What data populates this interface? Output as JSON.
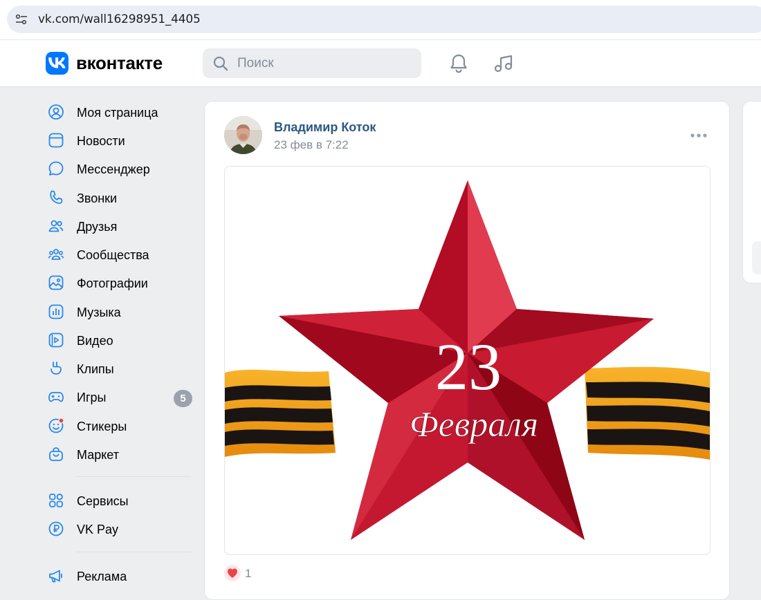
{
  "browser": {
    "url": "vk.com/wall16298951_4405"
  },
  "header": {
    "wordmark": "вконтакте",
    "search_placeholder": "Поиск",
    "accent_color": "#0077ff"
  },
  "sidebar": {
    "items": [
      {
        "label": "Моя страница",
        "icon": "profile-icon"
      },
      {
        "label": "Новости",
        "icon": "news-icon"
      },
      {
        "label": "Мессенджер",
        "icon": "messenger-icon"
      },
      {
        "label": "Звонки",
        "icon": "phone-icon"
      },
      {
        "label": "Друзья",
        "icon": "friends-icon"
      },
      {
        "label": "Сообщества",
        "icon": "communities-icon"
      },
      {
        "label": "Фотографии",
        "icon": "photos-icon"
      },
      {
        "label": "Музыка",
        "icon": "music-icon"
      },
      {
        "label": "Видео",
        "icon": "video-icon"
      },
      {
        "label": "Клипы",
        "icon": "clips-icon"
      },
      {
        "label": "Игры",
        "icon": "games-icon",
        "badge": "5"
      },
      {
        "label": "Стикеры",
        "icon": "stickers-icon"
      },
      {
        "label": "Маркет",
        "icon": "market-icon"
      },
      {
        "label": "Сервисы",
        "icon": "services-icon"
      },
      {
        "label": "VK Pay",
        "icon": "vkpay-icon"
      },
      {
        "label": "Реклама",
        "icon": "ads-icon"
      }
    ]
  },
  "post": {
    "author": "Владимир Коток",
    "date": "23 фев в 7:22",
    "image_text_number": "23",
    "image_text_month": "Февраля",
    "likes": "1"
  }
}
